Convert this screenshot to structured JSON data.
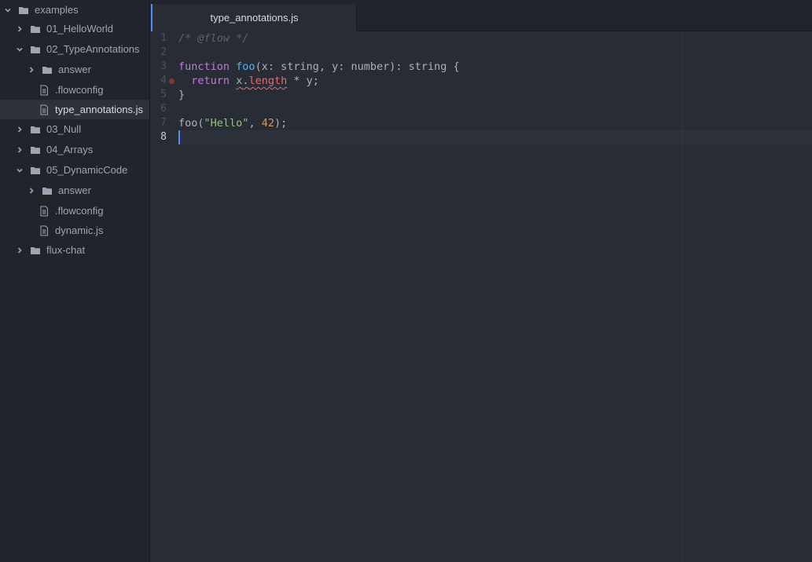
{
  "sidebar": {
    "items": [
      {
        "label": "examples",
        "kind": "folder",
        "expanded": true,
        "depth": 0,
        "selected": false
      },
      {
        "label": "01_HelloWorld",
        "kind": "folder",
        "expanded": false,
        "depth": 1,
        "selected": false
      },
      {
        "label": "02_TypeAnnotations",
        "kind": "folder",
        "expanded": true,
        "depth": 1,
        "selected": false
      },
      {
        "label": "answer",
        "kind": "folder",
        "expanded": false,
        "depth": 2,
        "selected": false
      },
      {
        "label": ".flowconfig",
        "kind": "file",
        "depth": 2,
        "selected": false
      },
      {
        "label": "type_annotations.js",
        "kind": "file",
        "depth": 2,
        "selected": true
      },
      {
        "label": "03_Null",
        "kind": "folder",
        "expanded": false,
        "depth": 1,
        "selected": false
      },
      {
        "label": "04_Arrays",
        "kind": "folder",
        "expanded": false,
        "depth": 1,
        "selected": false
      },
      {
        "label": "05_DynamicCode",
        "kind": "folder",
        "expanded": true,
        "depth": 1,
        "selected": false
      },
      {
        "label": "answer",
        "kind": "folder",
        "expanded": false,
        "depth": 2,
        "selected": false
      },
      {
        "label": ".flowconfig",
        "kind": "file",
        "depth": 2,
        "selected": false
      },
      {
        "label": "dynamic.js",
        "kind": "file",
        "depth": 2,
        "selected": false
      },
      {
        "label": "flux-chat",
        "kind": "folder",
        "expanded": false,
        "depth": 1,
        "selected": false
      }
    ]
  },
  "tabs": [
    {
      "label": "type_annotations.js",
      "active": true
    }
  ],
  "editor": {
    "lines": [
      {
        "num": "1",
        "tokens": [
          {
            "t": "/* @flow */",
            "c": "comment"
          }
        ]
      },
      {
        "num": "2",
        "tokens": []
      },
      {
        "num": "3",
        "tokens": [
          {
            "t": "function",
            "c": "keyword"
          },
          {
            "t": " ",
            "c": "plain"
          },
          {
            "t": "foo",
            "c": "func"
          },
          {
            "t": "(x: string, y: number): string {",
            "c": "plain"
          }
        ]
      },
      {
        "num": "4",
        "error": true,
        "tokens": [
          {
            "t": "  ",
            "c": "plain"
          },
          {
            "t": "return",
            "c": "keyword"
          },
          {
            "t": " ",
            "c": "plain"
          },
          {
            "t": "x",
            "c": "plain",
            "squiggle": true
          },
          {
            "t": ".",
            "c": "plain",
            "squiggle": true
          },
          {
            "t": "length",
            "c": "ident",
            "squiggle": true
          },
          {
            "t": " * y;",
            "c": "plain"
          }
        ]
      },
      {
        "num": "5",
        "tokens": [
          {
            "t": "}",
            "c": "plain"
          }
        ]
      },
      {
        "num": "6",
        "tokens": []
      },
      {
        "num": "7",
        "tokens": [
          {
            "t": "foo(",
            "c": "plain"
          },
          {
            "t": "\"Hello\"",
            "c": "string"
          },
          {
            "t": ", ",
            "c": "plain"
          },
          {
            "t": "42",
            "c": "number"
          },
          {
            "t": ");",
            "c": "plain"
          }
        ]
      },
      {
        "num": "8",
        "cursor": true,
        "tokens": []
      }
    ]
  },
  "colors": {
    "accent": "#528bff",
    "error": "#e06c75"
  }
}
